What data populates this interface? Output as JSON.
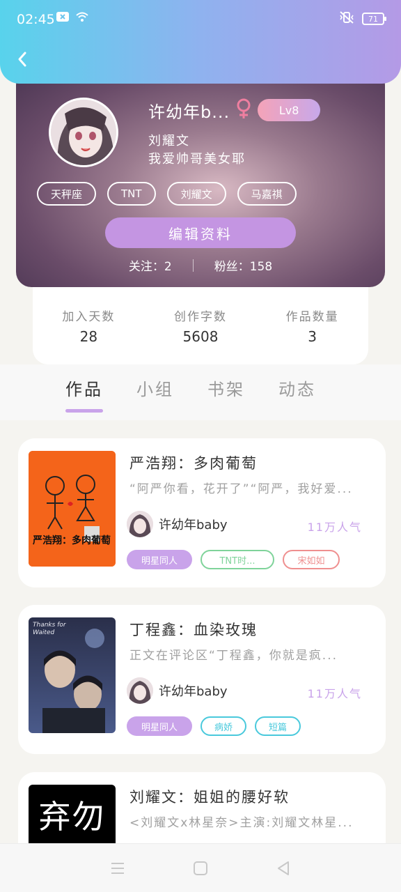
{
  "status_bar": {
    "time": "02:45",
    "battery": "71"
  },
  "profile": {
    "username": "许幼年b...",
    "level": "Lv8",
    "bio_line1": "刘耀文",
    "bio_line2": "我爱帅哥美女耶",
    "tags": [
      "天秤座",
      "TNT",
      "刘耀文",
      "马嘉祺"
    ],
    "edit_label": "编辑资料",
    "following": "关注：2",
    "followers": "粉丝：158"
  },
  "stats": [
    {
      "label": "加入天数",
      "value": "28"
    },
    {
      "label": "创作字数",
      "value": "5608"
    },
    {
      "label": "作品数量",
      "value": "3"
    }
  ],
  "tabs": [
    "作品",
    "小组",
    "书架",
    "动态"
  ],
  "works": [
    {
      "title": "严浩翔：多肉葡萄",
      "desc": "“阿严你看，花开了”“阿严，我好爱...",
      "author": "许幼年baby",
      "popularity": "11万人气",
      "tags": [
        "明星同人",
        "TNT时...",
        "宋如如"
      ],
      "cover_text": "严浩翔：多肉葡萄"
    },
    {
      "title": "丁程鑫：血染玫瑰",
      "desc": "正文在评论区“丁程鑫，你就是疯...",
      "author": "许幼年baby",
      "popularity": "11万人气",
      "tags": [
        "明星同人",
        "病娇",
        "短篇"
      ],
      "cover_text": "Thanks for Waited"
    },
    {
      "title": "刘耀文：姐姐的腰好软",
      "desc": "<刘耀文x林星奈>主演:刘耀文林星...",
      "cover_text": "弃勿"
    }
  ],
  "colors": {
    "accent": "#c9a3ea",
    "status_gradient_start": "#58d3ec",
    "status_gradient_end": "#b49ae6"
  }
}
